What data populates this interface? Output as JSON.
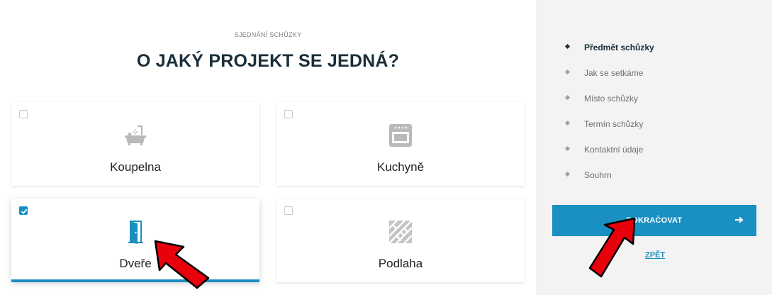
{
  "header": {
    "eyebrow": "SJEDNÁNÍ SCHŮZKY",
    "title": "O JAKÝ PROJEKT SE JEDNÁ?"
  },
  "options": [
    {
      "label": "Koupelna",
      "icon": "bathtub-icon",
      "checked": false
    },
    {
      "label": "Kuchyně",
      "icon": "oven-icon",
      "checked": false
    },
    {
      "label": "Dveře",
      "icon": "door-icon",
      "checked": true
    },
    {
      "label": "Podlaha",
      "icon": "floor-tiles-icon",
      "checked": false
    }
  ],
  "steps": [
    {
      "label": "Předmět schůzky",
      "active": true
    },
    {
      "label": "Jak se setkáme",
      "active": false
    },
    {
      "label": "Místo schůzky",
      "active": false
    },
    {
      "label": "Termín schůzky",
      "active": false
    },
    {
      "label": "Kontaktní údaje",
      "active": false
    },
    {
      "label": "Souhrn",
      "active": false
    }
  ],
  "actions": {
    "continue_label": "POKRAČOVAT",
    "back_label": "ZPĚT"
  },
  "colors": {
    "accent": "#1a8fc1",
    "heading": "#1a2e38",
    "sidebar_bg": "#f3f3f3",
    "annotation_arrow": "#e8000b"
  }
}
